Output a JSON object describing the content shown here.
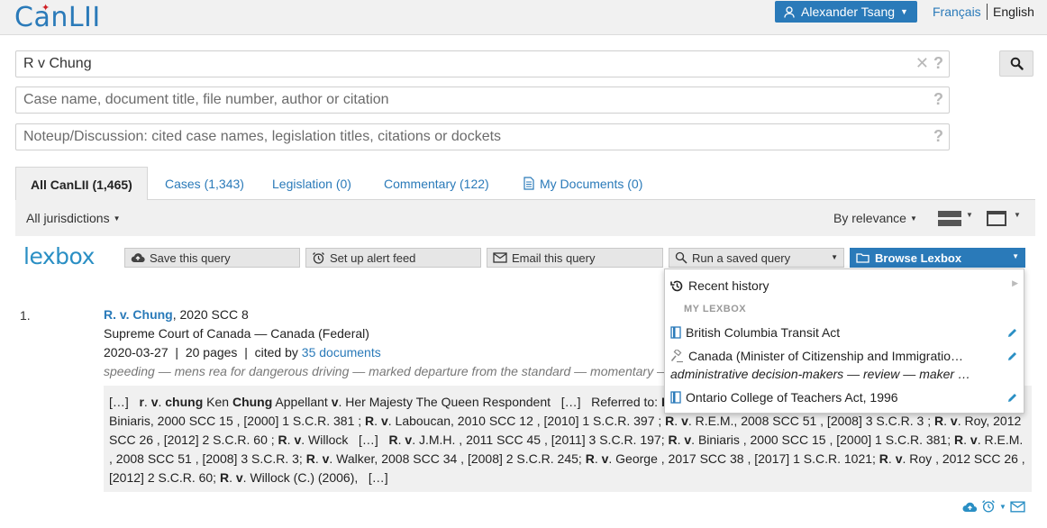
{
  "header": {
    "logo": "CanLII",
    "user_name": "Alexander Tsang",
    "lang_fr": "Français",
    "lang_en": "English"
  },
  "search": {
    "query_value": "R v Chung",
    "case_placeholder": "Case name, document title, file number, author or citation",
    "noteup_placeholder": "Noteup/Discussion: cited case names, legislation titles, citations or dockets"
  },
  "tabs": [
    {
      "label": "All CanLII (1,465)"
    },
    {
      "label": "Cases (1,343)"
    },
    {
      "label": "Legislation (0)"
    },
    {
      "label": "Commentary (122)"
    },
    {
      "label": "My Documents (0)"
    }
  ],
  "filters": {
    "jurisdiction": "All jurisdictions",
    "sort": "By relevance"
  },
  "lexbox": {
    "logo": "lexbox",
    "save_query": "Save this query",
    "alert_feed": "Set up alert feed",
    "email_query": "Email this query",
    "run_saved": "Run a saved query",
    "browse": "Browse Lexbox"
  },
  "dropdown": {
    "recent_history": "Recent history",
    "my_lexbox": "MY LEXBOX",
    "items": [
      {
        "label": "British Columbia Transit Act"
      },
      {
        "label": "Canada (Minister of Citizenship and Immigratio…",
        "sub": "administrative decision-makers — review — maker …"
      },
      {
        "label": "Ontario College of Teachers Act, 1996"
      }
    ]
  },
  "result": {
    "number": "1.",
    "title": "R. v. Chung",
    "citation": ", 2020 SCC 8",
    "court": "Supreme Court of Canada — Canada (Federal)",
    "date": "2020-03-27",
    "pages": "20 pages",
    "cited_prefix": "cited by ",
    "cited_link": "35 documents",
    "keywords": "speeding — mens rea for dangerous driving — marked departure from the standard — momentary —"
  }
}
